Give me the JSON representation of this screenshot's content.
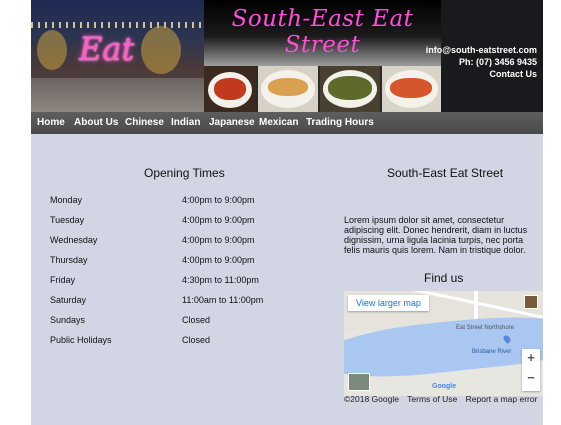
{
  "header": {
    "sign_text": "Eat",
    "title": "South-East Eat Street",
    "contact": {
      "email": "info@south-eatstreet.com",
      "phone": "Ph: (07) 3456 9435",
      "contact_link": "Contact Us"
    }
  },
  "nav": {
    "items": [
      "Home",
      "About Us",
      "Chinese",
      "Indian",
      "Japanese",
      "Mexican",
      "Trading Hours"
    ]
  },
  "opening": {
    "title": "Opening Times",
    "rows": [
      {
        "day": "Monday",
        "time": "4:00pm to 9:00pm"
      },
      {
        "day": "Tuesday",
        "time": "4:00pm to 9:00pm"
      },
      {
        "day": "Wednesday",
        "time": "4:00pm to 9:00pm"
      },
      {
        "day": "Thursday",
        "time": "4:00pm to 9:00pm"
      },
      {
        "day": "Friday",
        "time": "4:30pm to 11:00pm"
      },
      {
        "day": "Saturday",
        "time": "11:00am to 11:00pm"
      },
      {
        "day": "Sundays",
        "time": "Closed"
      },
      {
        "day": "Public Holidays",
        "time": "Closed"
      }
    ]
  },
  "about": {
    "title": "South-East Eat Street",
    "body": "Lorem ipsum dolor sit amet, consectetur adipiscing elit. Donec hendrerit, diam in luctus dignissim, urna ligula lacinia turpis, nec porta felis mauris quis lorem. Nam in tristique dolor."
  },
  "find": {
    "title": "Find us",
    "map": {
      "larger_link": "View larger map",
      "street_label": "Eat Street Northshore",
      "river_label": "Brisbane River",
      "zoom_in": "+",
      "zoom_out": "−",
      "google_logo": "Google"
    },
    "footer": {
      "copyright": "©2018 Google",
      "terms": "Terms of Use",
      "report": "Report a map error"
    }
  }
}
